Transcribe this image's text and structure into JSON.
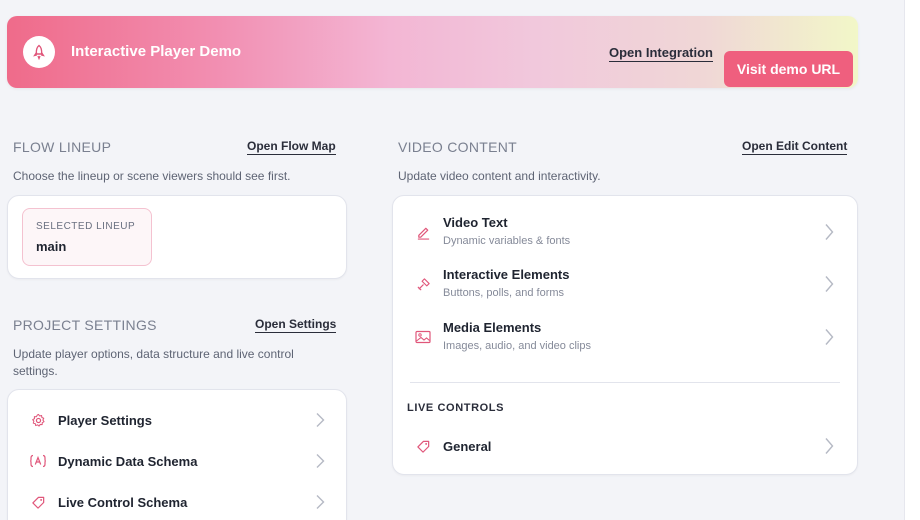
{
  "banner": {
    "title": "Interactive Player Demo",
    "open_integration": "Open Integration",
    "visit_demo": "Visit demo URL",
    "logo_icon": "rocket-icon"
  },
  "flow_lineup": {
    "title": "FLOW LINEUP",
    "link": "Open Flow Map",
    "description": "Choose the lineup or scene viewers should see first.",
    "selected_label": "SELECTED LINEUP",
    "selected_value": "main"
  },
  "project_settings": {
    "title": "PROJECT SETTINGS",
    "link": "Open Settings",
    "description_line1": "Update player options, data structure and live control",
    "description_line2": "settings.",
    "items": [
      {
        "label": "Player Settings",
        "icon": "gear-icon"
      },
      {
        "label": "Dynamic Data Schema",
        "icon": "variable-icon"
      },
      {
        "label": "Live Control Schema",
        "icon": "tag-icon"
      }
    ]
  },
  "video_content": {
    "title": "VIDEO CONTENT",
    "link": "Open Edit Content",
    "description": "Update video content and interactivity.",
    "items": [
      {
        "title": "Video Text",
        "subtitle": "Dynamic variables & fonts",
        "icon": "pen-icon"
      },
      {
        "title": "Interactive Elements",
        "subtitle": "Buttons, polls, and forms",
        "icon": "interactive-icon"
      },
      {
        "title": "Media Elements",
        "subtitle": "Images, audio, and video clips",
        "icon": "image-icon"
      }
    ],
    "live_controls_title": "LIVE CONTROLS",
    "live_items": [
      {
        "label": "General",
        "icon": "tag-icon"
      }
    ]
  },
  "colors": {
    "accent": "#ef5f7e",
    "icon_accent": "#e0567a",
    "background": "#f3f4f8"
  }
}
